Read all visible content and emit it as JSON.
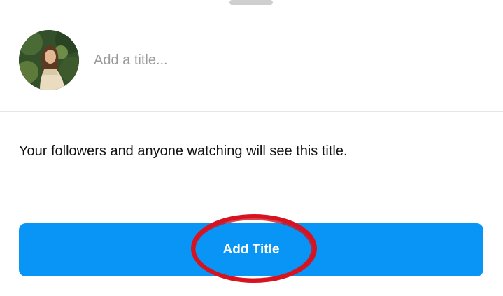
{
  "title_field": {
    "value": "",
    "placeholder": "Add a title..."
  },
  "info": {
    "text": "Your followers and anyone watching will see this title."
  },
  "actions": {
    "add_title_label": "Add Title"
  },
  "avatar": {
    "icon": "profile-photo"
  },
  "colors": {
    "primary_button": "#0895f6",
    "annotation": "#d6131f"
  }
}
